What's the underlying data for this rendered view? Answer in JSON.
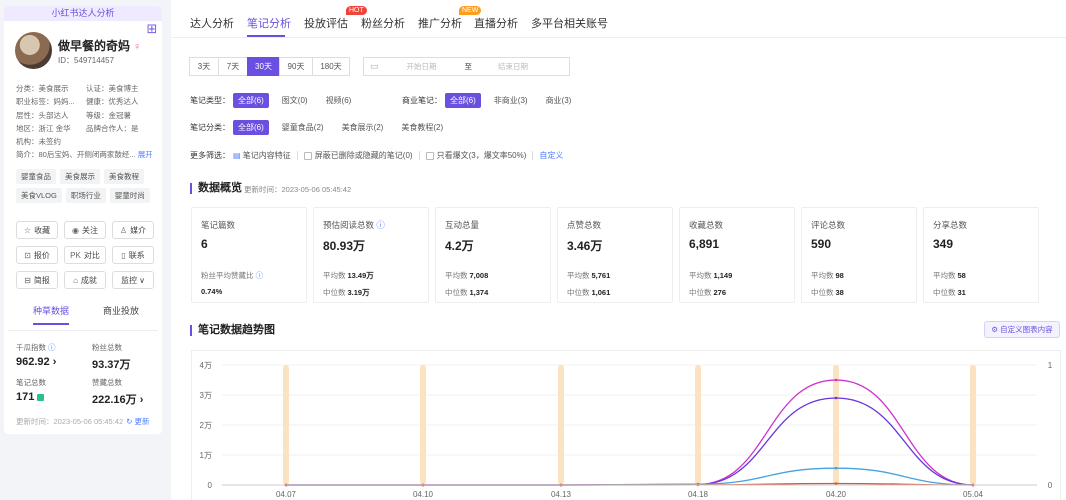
{
  "profile": {
    "banner": "小红书达人分析",
    "name": "做早餐的奇妈",
    "gender_symbol": "♀",
    "id": "ID：549714457",
    "info_rows": [
      [
        "分类：美食展示",
        "认证：美食博主"
      ],
      [
        "职业标签：妈妈...",
        "健康：优秀达人"
      ],
      [
        "层性：头部达人",
        "等级：金冠薯"
      ],
      [
        "地区：浙江 金华",
        "品牌合作人：是"
      ],
      [
        "机构：未签约",
        ""
      ]
    ],
    "intro": "简介：80后宝妈、开侧闭两家鼓经...",
    "intro_more": "展开",
    "tags": [
      "婴童食品",
      "美食展示",
      "美食教程",
      "美食VLOG",
      "职场行业",
      "婴童时尚"
    ],
    "buttons": [
      {
        "icon": "☆",
        "label": "收藏"
      },
      {
        "icon": "◉",
        "label": "关注"
      },
      {
        "icon": "♙",
        "label": "媒介"
      },
      {
        "icon": "⊡",
        "label": "报价"
      },
      {
        "icon": "PK",
        "label": "对比"
      },
      {
        "icon": "▯",
        "label": "联系"
      },
      {
        "icon": "⊟",
        "label": "简报"
      },
      {
        "icon": "⌂",
        "label": "成就"
      },
      {
        "icon": "",
        "label": "监控 ∨"
      }
    ],
    "subtabs": [
      "种草数据",
      "商业投放"
    ],
    "stats": {
      "qiangua_label": "千瓜指数",
      "qiangua_value": "962.92",
      "fans_label": "粉丝总数",
      "fans_value": "93.37万",
      "notes_label": "笔记总数",
      "notes_value": "171",
      "likes_label": "赞藏总数",
      "likes_value": "222.16万"
    },
    "update_time": "更新时间：2023-05-06 05:45:42",
    "update_link": "更新"
  },
  "nav": {
    "tabs": [
      "达人分析",
      "笔记分析",
      "投放评估",
      "粉丝分析",
      "推广分析",
      "直播分析",
      "多平台相关账号"
    ],
    "hot_badge": "HOT",
    "new_badge": "NEW"
  },
  "filters": {
    "days": [
      "3天",
      "7天",
      "30天",
      "90天",
      "180天"
    ],
    "date_start": "开始日期",
    "date_sep": "至",
    "date_end": "结束日期",
    "type_label": "笔记类型：",
    "type_options": [
      "全部(6)",
      "图文(0)",
      "视频(6)"
    ],
    "biz_label": "商业笔记：",
    "biz_options": [
      "全部(6)",
      "非商业(3)",
      "商业(3)"
    ],
    "cat_label": "笔记分类：",
    "cat_options": [
      "全部(6)",
      "婴童食品(2)",
      "美食展示(2)",
      "美食教程(2)"
    ],
    "more_label": "更多筛选：",
    "more_opt1": "笔记内容特征",
    "more_opt2": "屏蔽已删除或隐藏的笔记(0)",
    "more_opt3": "只看爆文(3，爆文率50%)",
    "more_link": "自定义"
  },
  "overview": {
    "title": "数据概览",
    "update_time": "更新时间：2023-05-06 05:45:42",
    "cards": [
      {
        "title": "笔记篇数",
        "value": "6",
        "sub1": "粉丝平均赞藏比",
        "sub1v": "",
        "sub2": "0.74%",
        "sub2v": ""
      },
      {
        "title": "预估阅读总数",
        "value": "80.93万",
        "sub1": "平均数",
        "sub1v": "13.49万",
        "sub2": "中位数",
        "sub2v": "3.19万"
      },
      {
        "title": "互动总量",
        "value": "4.2万",
        "sub1": "平均数",
        "sub1v": "7,008",
        "sub2": "中位数",
        "sub2v": "1,374"
      },
      {
        "title": "点赞总数",
        "value": "3.46万",
        "sub1": "平均数",
        "sub1v": "5,761",
        "sub2": "中位数",
        "sub2v": "1,061"
      },
      {
        "title": "收藏总数",
        "value": "6,891",
        "sub1": "平均数",
        "sub1v": "1,149",
        "sub2": "中位数",
        "sub2v": "276"
      },
      {
        "title": "评论总数",
        "value": "590",
        "sub1": "平均数",
        "sub1v": "98",
        "sub2": "中位数",
        "sub2v": "38"
      },
      {
        "title": "分享总数",
        "value": "349",
        "sub1": "平均数",
        "sub1v": "58",
        "sub2": "中位数",
        "sub2v": "31"
      }
    ]
  },
  "trend": {
    "title": "笔记数据趋势图",
    "custom_button": "自定义图表内容"
  },
  "chart_data": {
    "type": "line",
    "x": [
      "04.07",
      "04.10",
      "04.13",
      "04.18",
      "04.20",
      "05.04"
    ],
    "ylim": [
      0,
      40000
    ],
    "y_ticks": [
      "0",
      "1万",
      "2万",
      "3万",
      "4万"
    ],
    "y2lim": [
      0,
      1
    ],
    "y2_ticks": [
      "0",
      "1"
    ],
    "bars_note_markers": [
      1,
      1,
      1,
      1,
      1,
      1
    ],
    "series": [
      {
        "color": "#cc33cc",
        "values": [
          0,
          0,
          0,
          200,
          35000,
          0
        ]
      },
      {
        "color": "#6633dd",
        "values": [
          0,
          0,
          0,
          150,
          29000,
          0
        ]
      },
      {
        "color": "#44a3e0",
        "values": [
          0,
          0,
          0,
          300,
          5600,
          0
        ]
      },
      {
        "color": "#dd5533",
        "values": [
          0,
          0,
          0,
          50,
          500,
          0
        ]
      }
    ],
    "colors": {
      "bar": "#fbe3c2",
      "accent": "#6a4fe0"
    }
  }
}
